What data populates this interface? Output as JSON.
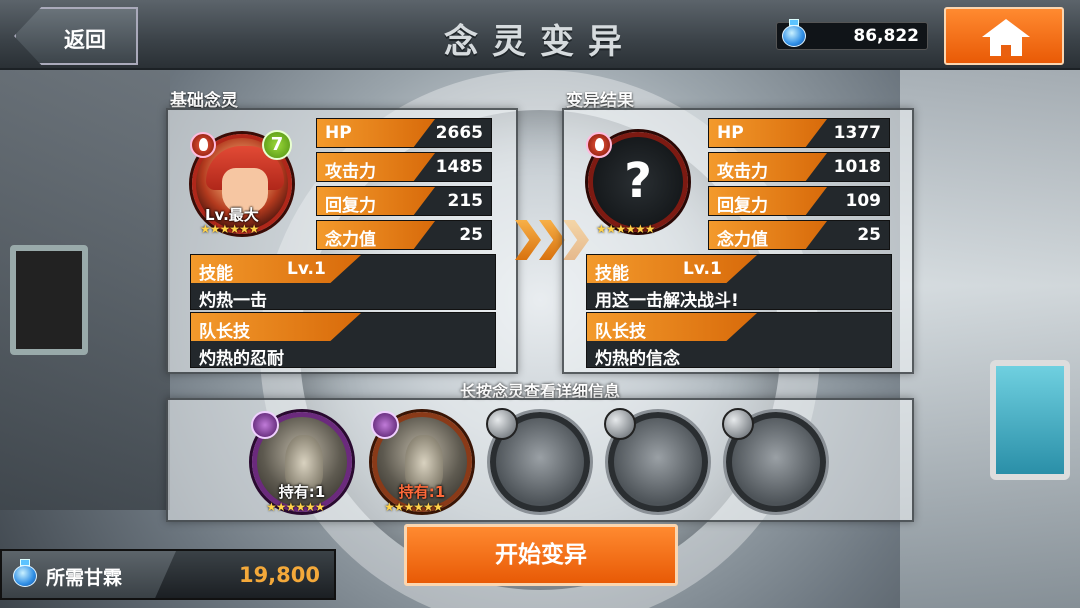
{
  "header": {
    "back_label": "返回",
    "title": "念灵变异",
    "currency_value": "86,822"
  },
  "base": {
    "section_label": "基础念灵",
    "level_badge": "7",
    "level_text": "Lv.最大",
    "stars": "★★★★★★",
    "stats": [
      {
        "label": "HP",
        "value": "2665"
      },
      {
        "label": "攻击力",
        "value": "1485"
      },
      {
        "label": "回复力",
        "value": "215"
      },
      {
        "label": "念力值",
        "value": "25"
      }
    ],
    "skill": {
      "header": "技能",
      "level": "Lv.1",
      "name": "灼热一击"
    },
    "leader": {
      "header": "队长技",
      "name": "灼热的忍耐"
    }
  },
  "result": {
    "section_label": "变异结果",
    "mystery": "?",
    "stars": "★★★★★★",
    "stats": [
      {
        "label": "HP",
        "value": "1377"
      },
      {
        "label": "攻击力",
        "value": "1018"
      },
      {
        "label": "回复力",
        "value": "109"
      },
      {
        "label": "念力值",
        "value": "25"
      }
    ],
    "skill": {
      "header": "技能",
      "level": "Lv.1",
      "name": "用这一击解决战斗!"
    },
    "leader": {
      "header": "队长技",
      "name": "灼热的信念"
    }
  },
  "materials": {
    "hint": "长按念灵查看详细信息",
    "cards": [
      {
        "owned": "持有:1",
        "stars": "★★★★★★"
      },
      {
        "owned": "持有:1",
        "stars": "★★★★★★"
      }
    ],
    "empty_slots": 3
  },
  "footer": {
    "cost_label": "所需甘霖",
    "cost_value": "19,800",
    "start_label": "开始变异"
  },
  "colors": {
    "accent": "#e96010",
    "stat_label": "#f39a2c"
  }
}
